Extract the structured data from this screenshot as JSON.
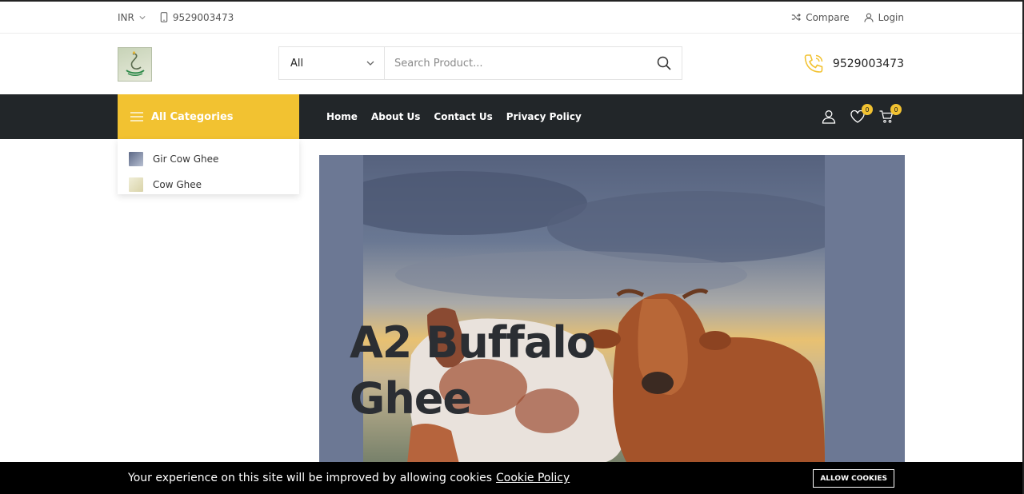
{
  "topbar": {
    "currency": "INR",
    "phone": "9529003473",
    "compare_label": "Compare",
    "login_label": "Login"
  },
  "header": {
    "search_category": "All",
    "search_placeholder": "Search Product...",
    "phone": "9529003473"
  },
  "nav": {
    "all_categories_label": "All Categories",
    "links": [
      {
        "label": "Home"
      },
      {
        "label": "About Us"
      },
      {
        "label": "Contact Us"
      },
      {
        "label": "Privacy Policy"
      }
    ],
    "wishlist_count": "0",
    "cart_count": "0"
  },
  "categories": [
    {
      "label": "Gir Cow Ghee",
      "thumb_color": "#7d8aa8"
    },
    {
      "label": "Cow Ghee",
      "thumb_color": "#e7e3c8"
    }
  ],
  "hero": {
    "title_line1": "A2 Buffalo",
    "title_line2": "Ghee"
  },
  "cookie": {
    "message": "Your experience on this site will be improved by allowing cookies",
    "policy_link": "Cookie Policy",
    "button_label": "ALLOW COOKIES"
  },
  "colors": {
    "accent": "#f2c231",
    "navbar": "#222629",
    "hero_bg": "#6c7894"
  }
}
